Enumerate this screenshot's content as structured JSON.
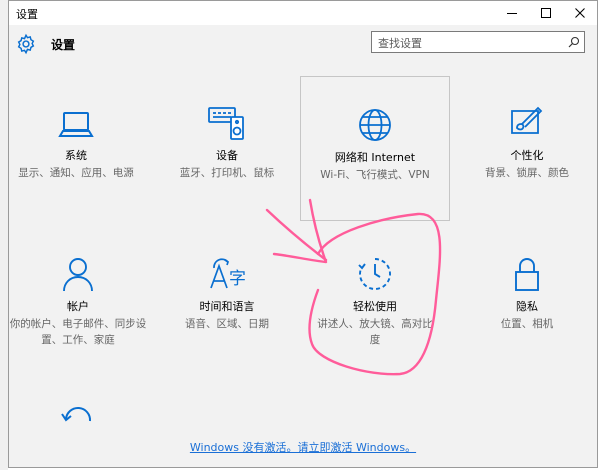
{
  "window": {
    "title": "设置",
    "controls": {
      "minimize": "minimize",
      "maximize": "maximize",
      "close": "close"
    }
  },
  "header": {
    "title": "设置",
    "search_placeholder": "查找设置"
  },
  "tiles": [
    {
      "id": "system",
      "name": "系统",
      "desc": "显示、通知、应用、电源",
      "icon": "laptop-icon"
    },
    {
      "id": "devices",
      "name": "设备",
      "desc": "蓝牙、打印机、鼠标",
      "icon": "devices-icon"
    },
    {
      "id": "network",
      "name": "网络和 Internet",
      "desc": "Wi-Fi、飞行模式、VPN",
      "icon": "globe-icon"
    },
    {
      "id": "personalization",
      "name": "个性化",
      "desc": "背景、锁屏、颜色",
      "icon": "paint-icon"
    },
    {
      "id": "accounts",
      "name": "帐户",
      "desc": "你的帐户、电子邮件、同步设置、工作、家庭",
      "icon": "person-icon"
    },
    {
      "id": "time",
      "name": "时间和语言",
      "desc": "语音、区域、日期",
      "icon": "language-icon"
    },
    {
      "id": "ease",
      "name": "轻松使用",
      "desc": "讲述人、放大镜、高对比度",
      "icon": "ease-of-access-icon"
    },
    {
      "id": "privacy",
      "name": "隐私",
      "desc": "位置、相机",
      "icon": "lock-icon"
    },
    {
      "id": "update",
      "name": "",
      "desc": "",
      "icon": "update-icon"
    }
  ],
  "activation_link": "Windows 没有激活。请立即激活 Windows。",
  "colors": {
    "accent": "#0a6fd0",
    "annotation": "#ff5c9a",
    "link": "#1a6fd6"
  }
}
